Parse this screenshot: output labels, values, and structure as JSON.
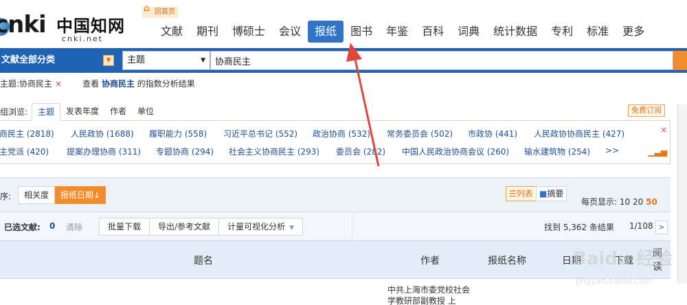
{
  "header": {
    "logo_latin": "cnki",
    "logo_cn": "中国知网",
    "logo_sub": "cnki.net",
    "home_link": "回首页",
    "nav": [
      "文献",
      "期刊",
      "博硕士",
      "会议",
      "报纸",
      "图书",
      "年鉴",
      "百科",
      "词典",
      "统计数据",
      "专利",
      "标准",
      "更多"
    ],
    "active_nav": "报纸"
  },
  "search": {
    "category_label": "文献全部分类",
    "field_value": "主题",
    "query_value": "协商民主"
  },
  "query_status": {
    "tag": "主题:协商民主",
    "close": "×",
    "index_prefix": "查看",
    "index_term": "协商民主",
    "index_suffix": "的指数分析结果"
  },
  "group": {
    "label": "组浏览:",
    "tabs": [
      "主题",
      "发表年度",
      "作者",
      "单位"
    ],
    "active_tab": "主题",
    "free_subscribe": "免费订阅",
    "row1": [
      "商民主 (2818)",
      "人民政协 (1688)",
      "履职能力 (558)",
      "习近平总书记 (552)",
      "政治协商 (532)",
      "常务委员会 (502)",
      "市政协 (441)",
      "人民政协协商民主 (427)"
    ],
    "row2": [
      "主党派 (420)",
      "提案办理协商 (311)",
      "专题协商 (294)",
      "社会主义协商民主 (293)",
      "委员会 (282)",
      "中国人民政治协商会议 (260)",
      "输水建筑物 (254)",
      ">>"
    ],
    "close": "×",
    "chart_icon": "chart-icon"
  },
  "sort": {
    "label": "序:",
    "relevance": "相关度",
    "date": "报纸日期",
    "date_arrow": "↓",
    "view_list": "列表",
    "view_abstract": "摘要",
    "per_page_label": "每页显示:",
    "per_page_options": [
      "10",
      "20",
      "50"
    ],
    "per_page_active": "50"
  },
  "toolbar": {
    "selected_label": "已选文献:",
    "selected_count": "0",
    "clear": "清除",
    "batch_download": "批量下载",
    "export": "导出/参考文献",
    "viz": "计量可视化分析",
    "found": "找到 5,362 条结果",
    "pager": "1/108",
    "next": ">"
  },
  "table": {
    "headers": {
      "title": "题名",
      "author": "作者",
      "paper": "报纸名称",
      "date": "日期",
      "download": "下载",
      "read": "阅读"
    },
    "first_row_author": "中共上海市委党校社会学教研部副教授 上"
  },
  "watermark": {
    "text": "Baidu 经验",
    "sub": "jingyan.baidu.com"
  },
  "colors": {
    "brand_blue": "#1f63b7",
    "nav_active": "#3173c6",
    "accent_orange": "#f08c2c",
    "link_blue": "#1f4e94",
    "arrow_red": "#e0463a"
  }
}
